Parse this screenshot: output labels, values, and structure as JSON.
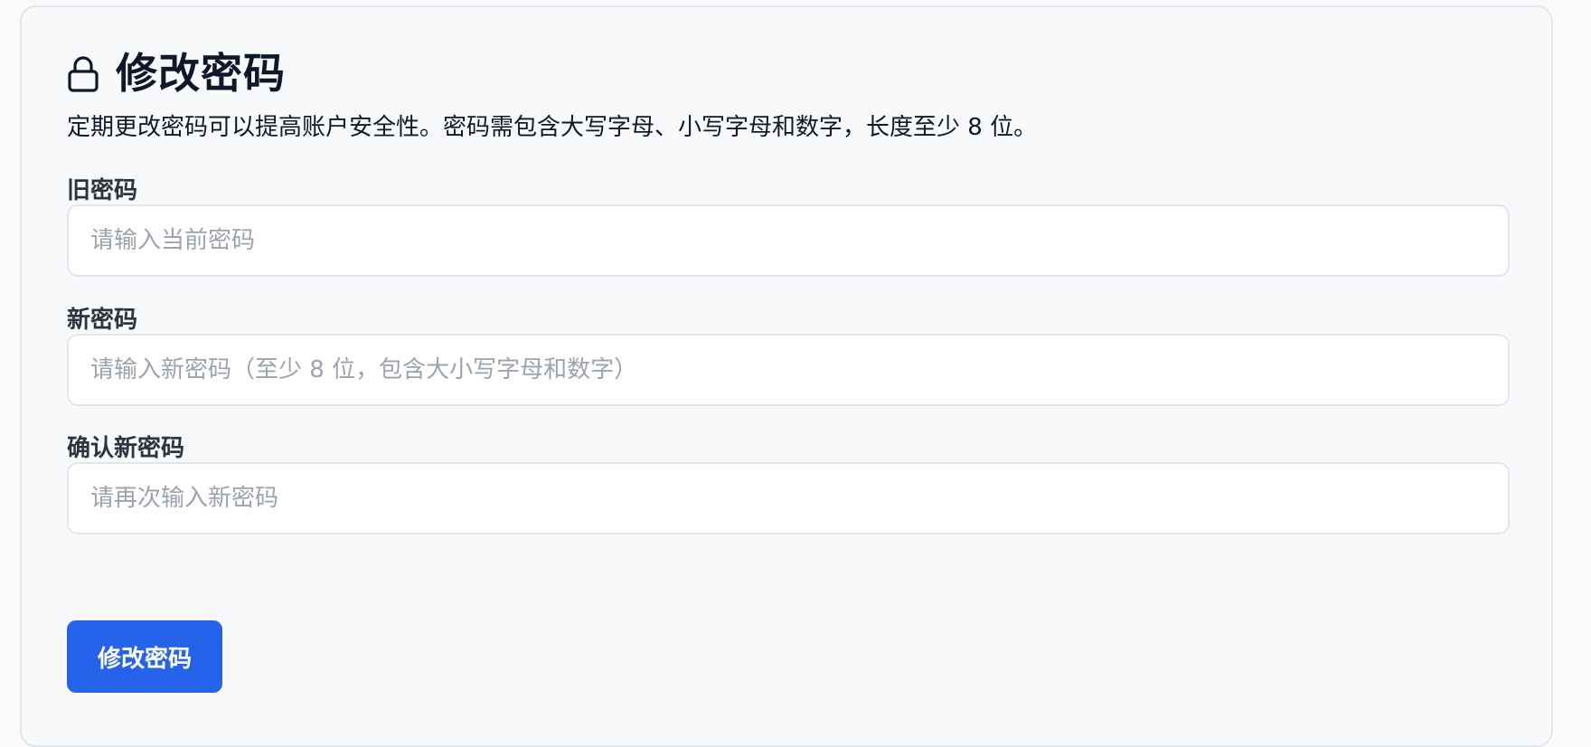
{
  "header": {
    "icon": "lock-icon",
    "title": "修改密码"
  },
  "description": "定期更改密码可以提高账户安全性。密码需包含大写字母、小写字母和数字，长度至少 8 位。",
  "fields": [
    {
      "label": "旧密码",
      "placeholder": "请输入当前密码",
      "value": ""
    },
    {
      "label": "新密码",
      "placeholder": "请输入新密码（至少 8 位，包含大小写字母和数字）",
      "value": ""
    },
    {
      "label": "确认新密码",
      "placeholder": "请再次输入新密码",
      "value": ""
    }
  ],
  "submit_button": {
    "label": "修改密码"
  },
  "colors": {
    "primary": "#2563eb",
    "background": "#f8f9fb",
    "border": "#e1e6ee",
    "placeholder": "#9ca3af"
  }
}
